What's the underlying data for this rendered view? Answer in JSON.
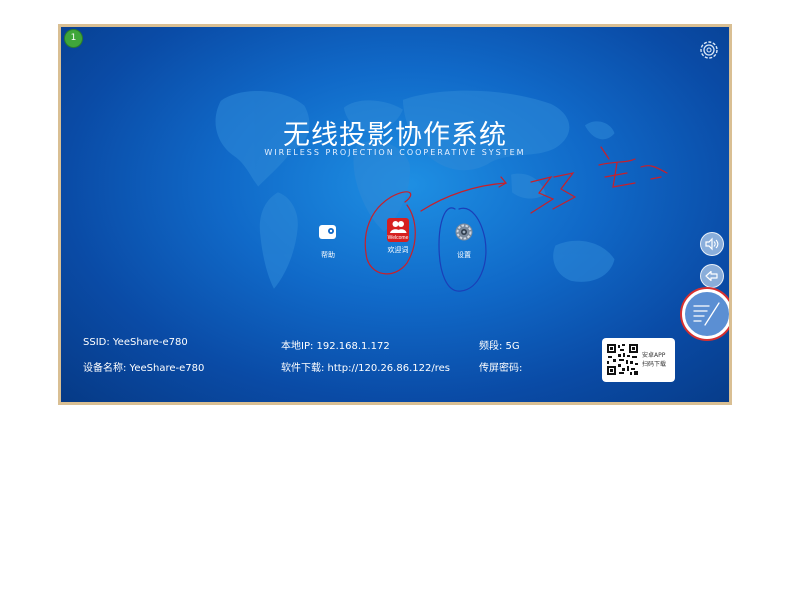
{
  "badge": {
    "count": "1"
  },
  "header": {
    "title": "无线投影协作系统",
    "subtitle": "WIRELESS PROJECTION COOPERATIVE SYSTEM"
  },
  "apps": [
    {
      "label": "帮助",
      "icon": "help-icon"
    },
    {
      "label": "欢迎词",
      "icon": "welcome-icon",
      "badge_text": "Welcome"
    },
    {
      "label": "设置",
      "icon": "gear-icon"
    }
  ],
  "info": {
    "ssid": "SSID: YeeShare-e780",
    "device_name": "设备名称: YeeShare-e780",
    "local_ip": "本地IP: 192.168.1.172",
    "download": "软件下载: http://120.26.86.122/res",
    "band": "频段: 5G",
    "password": "传屏密码:"
  },
  "qr": {
    "line1": "安卓APP",
    "line2": "扫码下载"
  },
  "side_toolbar": {
    "icons": [
      "volume-icon",
      "back-arrow-icon",
      "pen-annotation-icon"
    ]
  },
  "colors": {
    "background": "#1069c8",
    "frame": "#d9bf93",
    "badge": "#3fa63a",
    "welcome_red": "#d62020",
    "annotation_red": "#c8202a",
    "annotation_blue": "#1a3fb8"
  }
}
